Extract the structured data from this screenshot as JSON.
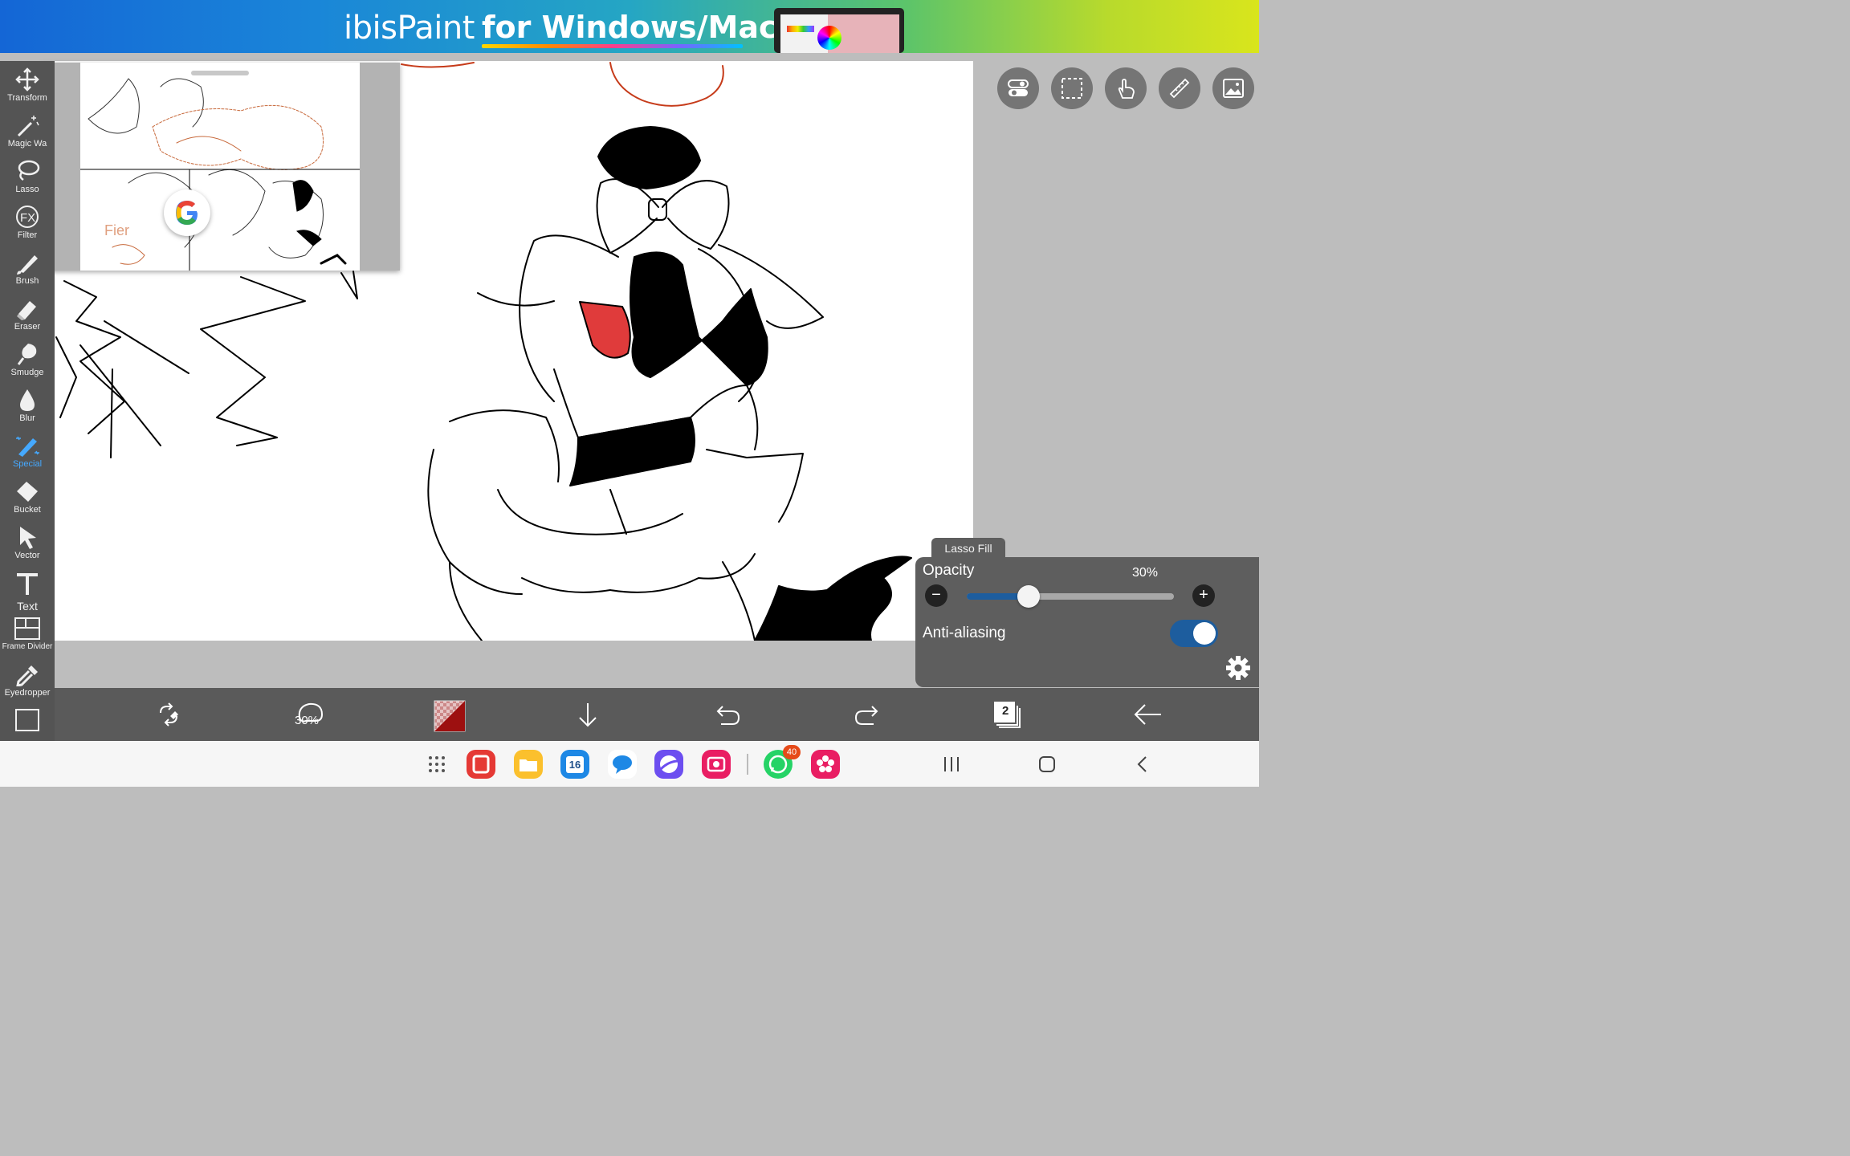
{
  "banner": {
    "brand": "ibisPaint",
    "tagline": "for Windows/Mac"
  },
  "toolbar": {
    "tools": [
      {
        "label": "Transform",
        "icon": "move-arrows-icon"
      },
      {
        "label": "Magic Wa",
        "icon": "magic-wand-icon"
      },
      {
        "label": "Lasso",
        "icon": "lasso-icon"
      },
      {
        "label": "Filter",
        "icon": "fx-icon"
      },
      {
        "label": "Brush",
        "icon": "brush-icon"
      },
      {
        "label": "Eraser",
        "icon": "eraser-icon"
      },
      {
        "label": "Smudge",
        "icon": "smudge-icon"
      },
      {
        "label": "Blur",
        "icon": "drop-icon"
      },
      {
        "label": "Special",
        "icon": "special-pen-icon",
        "active": true
      },
      {
        "label": "Bucket",
        "icon": "bucket-icon"
      },
      {
        "label": "Vector",
        "icon": "cursor-arrow-icon"
      },
      {
        "label": "Text",
        "icon": "text-t-icon"
      },
      {
        "label": "Frame Divider",
        "icon": "frame-divider-icon"
      },
      {
        "label": "Eyedropper",
        "icon": "eyedropper-icon"
      }
    ],
    "active_color": "#45a9ff"
  },
  "reference_window": {
    "sketch_text": "Fier",
    "google_button_icon": "google-g-icon"
  },
  "quick_buttons": [
    "toggle-icon",
    "selection-icon",
    "hand-touch-icon",
    "ruler-icon",
    "reference-image-icon"
  ],
  "lasso_panel": {
    "tab_label": "Lasso Fill",
    "opacity_label": "Opacity",
    "opacity_value": "30%",
    "opacity_fraction": 0.3,
    "minus": "−",
    "plus": "+",
    "antialias_label": "Anti-aliasing",
    "antialias_on": true
  },
  "bottom_bar": {
    "brush_size_label": "30%",
    "layer_count": "2",
    "primary_color": "#9d1010",
    "icons": [
      "swap-icon",
      "brush-size-icon",
      "color-swatch",
      "download-arrow-icon",
      "undo-icon",
      "redo-icon",
      "layers-icon",
      "back-arrow-icon"
    ]
  },
  "navbar": {
    "whatsapp_badge": "40",
    "calendar_day": "16",
    "apps": [
      "app-drawer-icon",
      "flipboard-icon",
      "files-icon",
      "calendar-icon",
      "messages-icon",
      "internet-icon",
      "screen-recorder-icon",
      "whatsapp-icon",
      "gallery-icon"
    ],
    "buttons": [
      "recents-button",
      "home-button",
      "back-button"
    ]
  }
}
